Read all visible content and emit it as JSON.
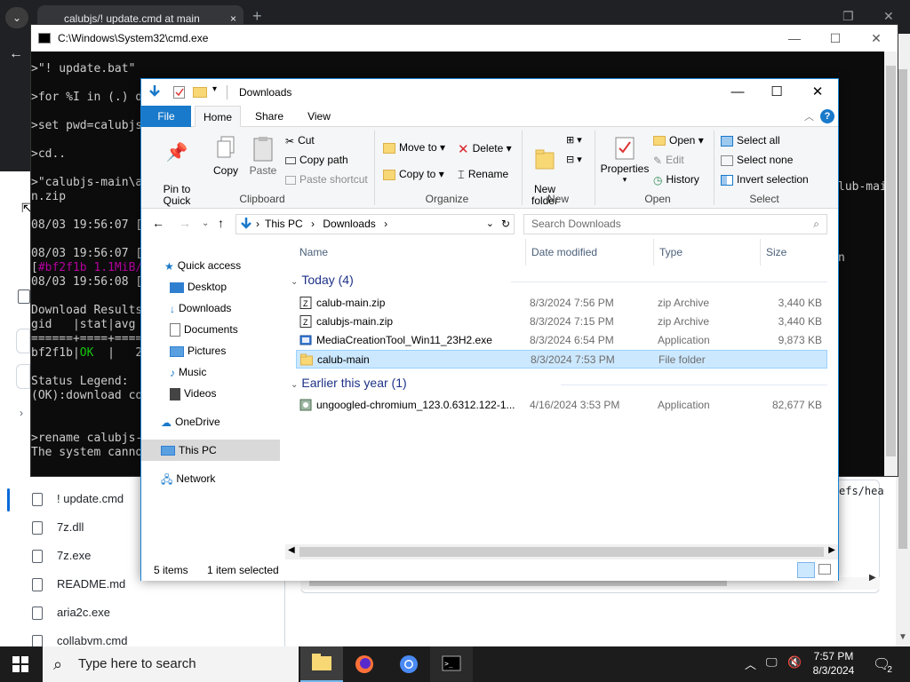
{
  "browser": {
    "tab_title": "calubjs/! update.cmd at main",
    "tab_close": "×",
    "new_tab": "+",
    "collapse_arrow": "⌄",
    "back": "←",
    "repo_files": [
      "! update.cmd",
      "7z.dll",
      "7z.exe",
      "README.md",
      "aria2c.exe",
      "collabvm.cmd"
    ],
    "ref_text": "efs/hea"
  },
  "cmd": {
    "title": "C:\\Windows\\System32\\cmd.exe",
    "lines": [
      ">\"! update.bat\"",
      "",
      ">for %I in (.) d",
      "",
      ">set pwd=calubjs",
      "",
      ">cd..",
      "",
      ">\"calubjs-main\\a",
      "n.zip",
      "",
      "08/03 19:56:07 [",
      "",
      "08/03 19:56:07 [",
      "[#bf2f1b 1.1MiB/",
      "08/03 19:56:08 [",
      "",
      "Download Results",
      "gid   |stat|avg",
      "======+====+====",
      "bf2f1b|OK  |   2",
      "",
      "Status Legend:",
      "(OK):download co",
      "",
      "",
      ">rename calubjs-",
      "The system canno",
      "",
      ">"
    ],
    "right_text_1": "lub-main",
    "right_text_2": "n"
  },
  "explorer": {
    "title": "Downloads",
    "tabs": {
      "file": "File",
      "home": "Home",
      "share": "Share",
      "view": "View"
    },
    "help": "?",
    "ribbon": {
      "pin": "Pin to Quick\naccess",
      "copy": "Copy",
      "paste": "Paste",
      "cut": "Cut",
      "copy_path": "Copy path",
      "paste_shortcut": "Paste shortcut",
      "move_to": "Move to",
      "copy_to": "Copy to",
      "delete": "Delete",
      "rename": "Rename",
      "new_folder": "New\nfolder",
      "properties": "Properties",
      "open": "Open",
      "edit": "Edit",
      "history": "History",
      "select_all": "Select all",
      "select_none": "Select none",
      "invert_selection": "Invert selection",
      "groups": {
        "clipboard": "Clipboard",
        "organize": "Organize",
        "new": "New",
        "open": "Open",
        "select": "Select"
      }
    },
    "address": {
      "this_pc": "This PC",
      "sep": "›",
      "downloads": "Downloads",
      "search_placeholder": "Search Downloads"
    },
    "nav": {
      "quick_access": "Quick access",
      "desktop": "Desktop",
      "downloads": "Downloads",
      "documents": "Documents",
      "pictures": "Pictures",
      "music": "Music",
      "videos": "Videos",
      "onedrive": "OneDrive",
      "this_pc": "This PC",
      "network": "Network"
    },
    "columns": {
      "name": "Name",
      "date": "Date modified",
      "type": "Type",
      "size": "Size"
    },
    "groups": {
      "today": "Today (4)",
      "earlier": "Earlier this year (1)"
    },
    "files": [
      {
        "name": "calub-main.zip",
        "date": "8/3/2024 7:56 PM",
        "type": "zip Archive",
        "size": "3,440 KB"
      },
      {
        "name": "calubjs-main.zip",
        "date": "8/3/2024 7:15 PM",
        "type": "zip Archive",
        "size": "3,440 KB"
      },
      {
        "name": "MediaCreationTool_Win11_23H2.exe",
        "date": "8/3/2024 6:54 PM",
        "type": "Application",
        "size": "9,873 KB"
      },
      {
        "name": "calub-main",
        "date": "8/3/2024 7:53 PM",
        "type": "File folder",
        "size": ""
      },
      {
        "name": "ungoogled-chromium_123.0.6312.122-1....",
        "date": "4/16/2024 3:53 PM",
        "type": "Application",
        "size": "82,677 KB"
      }
    ],
    "status": {
      "count": "5 items",
      "selected": "1 item selected"
    }
  },
  "taskbar": {
    "search_placeholder": "Type here to search",
    "time": "7:57 PM",
    "date": "8/3/2024",
    "notifications": "2"
  },
  "colors": {
    "accent": "#1979ca",
    "selection": "#cce8ff",
    "taskbar": "#1c1c1c",
    "console_ok": "#16c60c"
  }
}
